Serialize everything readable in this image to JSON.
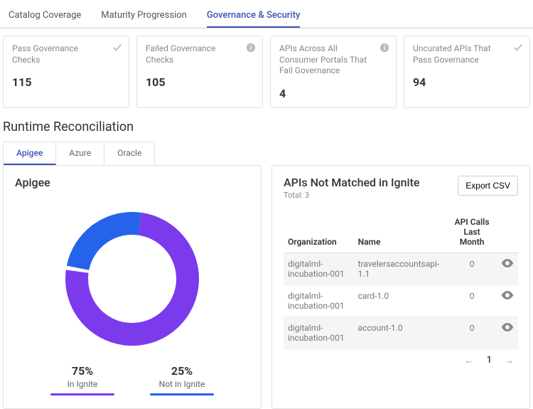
{
  "top_tabs": {
    "catalog": "Catalog Coverage",
    "maturity": "Maturity Progression",
    "governance": "Governance & Security"
  },
  "stats": {
    "pass": {
      "title": "Pass Governance Checks",
      "value": "115"
    },
    "failed": {
      "title": "Failed Governance Checks",
      "value": "105"
    },
    "portals": {
      "title": "APIs Across All Consumer Portals That Fail Governance",
      "value": "4"
    },
    "uncurated": {
      "title": "Uncurated APIs That Pass Governance",
      "value": "94"
    }
  },
  "section_heading": "Runtime Reconciliation",
  "sub_tabs": {
    "apigee": "Apigee",
    "azure": "Azure",
    "oracle": "Oracle"
  },
  "left_panel": {
    "title": "Apigee",
    "legend": {
      "inIgnite": {
        "pct": "75%",
        "label": "In Ignite"
      },
      "notInIgnite": {
        "pct": "25%",
        "label": "Not in Ignite"
      }
    }
  },
  "right_panel": {
    "title": "APIs Not Matched in Ignite",
    "subtotal": "Total: 3",
    "export_btn": "Export CSV",
    "columns": {
      "org": "Organization",
      "name": "Name",
      "calls": "API Calls Last Month"
    },
    "rows": [
      {
        "org": "digitalml-incubation-001",
        "name": "travelersaccountsapi-1.1",
        "calls": "0"
      },
      {
        "org": "digitalml-incubation-001",
        "name": "card-1.0",
        "calls": "0"
      },
      {
        "org": "digitalml-incubation-001",
        "name": "account-1.0",
        "calls": "0"
      }
    ],
    "pager": {
      "current": "1"
    }
  },
  "chart_data": {
    "type": "pie",
    "title": "Apigee",
    "categories": [
      "In Ignite",
      "Not in Ignite"
    ],
    "values": [
      75,
      25
    ],
    "colors": [
      "#7c3aed",
      "#2563eb"
    ]
  }
}
